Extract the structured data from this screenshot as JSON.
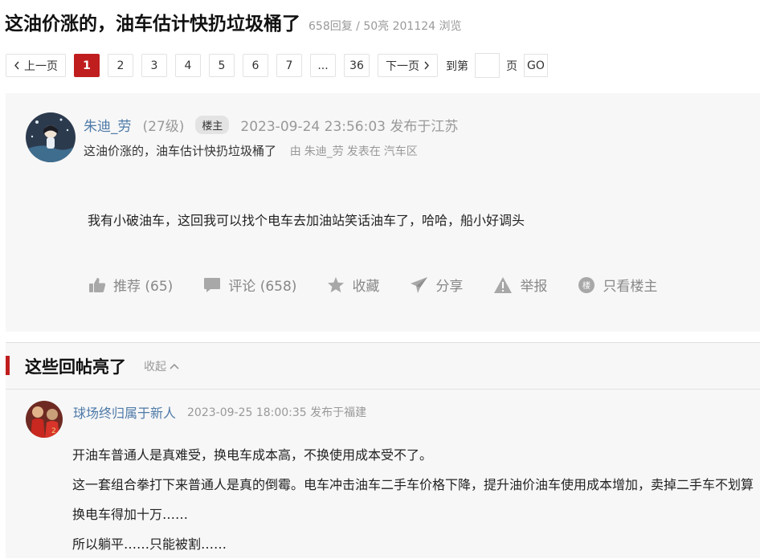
{
  "thread": {
    "title": "这油价涨的，油车估计快扔垃圾桶了",
    "stats": "658回复 / 50亮 201124 浏览"
  },
  "pager": {
    "prev": "上一页",
    "pages": [
      "1",
      "2",
      "3",
      "4",
      "5",
      "6",
      "7",
      "...",
      "36"
    ],
    "next": "下一页",
    "goto_label": "到第",
    "page_unit": "页",
    "go": "GO"
  },
  "post": {
    "username": "朱迪_劳",
    "level": "(27级)",
    "badge": "楼主",
    "time_location": "2023-09-24 23:56:03 发布于江苏",
    "subtitle": "这油价涨的，油车估计快扔垃圾桶了",
    "by_prefix": "由",
    "by_user": "朱迪_劳",
    "by_middle": "发表在",
    "forum": "汽车区",
    "content": "我有小破油车，这回我可以找个电车去加油站笑话油车了，哈哈，船小好调头",
    "actions": {
      "recommend": "推荐 (65)",
      "comment": "评论 (658)",
      "favorite": "收藏",
      "share": "分享",
      "report": "举报",
      "only_op": "只看楼主"
    }
  },
  "highlights": {
    "title": "这些回帖亮了",
    "collapse": "收起",
    "reply": {
      "username": "球场终归属于新人",
      "time_location": "2023-09-25 18:00:35 发布于福建",
      "lines": [
        "开油车普通人是真难受，换电车成本高，不换使用成本受不了。",
        "这一套组合拳打下来普通人是真的倒霉。电车冲击油车二手车价格下降，提升油价油车使用成本增加，卖掉二手车不划算换电车得加十万……",
        "所以躺平……只能被割……"
      ]
    }
  },
  "colors": {
    "accent_red": "#c01e1e",
    "link_blue": "#4e7aa8",
    "muted": "#999999"
  },
  "icons": [
    "chevron-left-icon",
    "chevron-right-icon",
    "thumb-up-icon",
    "comment-icon",
    "star-icon",
    "share-icon",
    "warning-icon",
    "op-badge-icon",
    "chevron-up-icon"
  ]
}
